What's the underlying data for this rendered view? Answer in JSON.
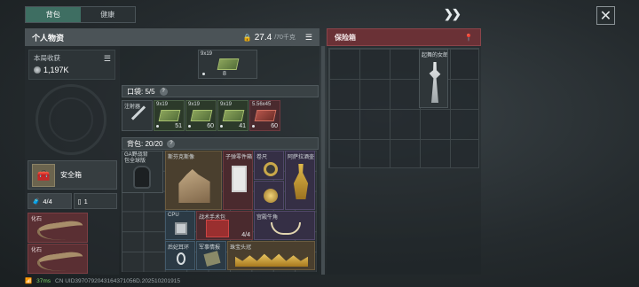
{
  "tabs": [
    {
      "label": "背包",
      "active": true
    },
    {
      "label": "健康",
      "active": false
    }
  ],
  "personal": {
    "title": "个人物资",
    "weight_value": "27.4",
    "weight_max": "/70千克"
  },
  "safe_panel": {
    "title": "保险箱"
  },
  "income": {
    "label": "本局收获",
    "value": "1,197K"
  },
  "safebox": {
    "label": "安全箱"
  },
  "counts": [
    {
      "value": "4/4"
    },
    {
      "value": "1"
    }
  ],
  "fossils": [
    {
      "label": "化石"
    },
    {
      "label": "化石"
    }
  ],
  "top_ammo": {
    "name": "9x19",
    "count": "8"
  },
  "pockets": {
    "label": "口袋: 5/5",
    "help": "?",
    "items": [
      {
        "name": "注射器",
        "count": ""
      },
      {
        "name": "9x19",
        "count": "51"
      },
      {
        "name": "9x19",
        "count": "60"
      },
      {
        "name": "9x19",
        "count": "41"
      },
      {
        "name": "5.56x45",
        "count": "60"
      }
    ]
  },
  "backpack": {
    "label": "背包: 20/20",
    "help": "?",
    "items": [
      {
        "name": "GA野战背包全球版"
      },
      {
        "name": "斯芬克斯像"
      },
      {
        "name": "子弹零件箱"
      },
      {
        "name": "卷尺"
      },
      {
        "name": "阿萨拉酒壶"
      },
      {
        "name": "CPU"
      },
      {
        "name": "战术手术包",
        "count": "4/4"
      },
      {
        "name": "宫殿牛角"
      },
      {
        "name": "后妃耳环"
      },
      {
        "name": "军事情报"
      },
      {
        "name": "珠宝头冠"
      }
    ]
  },
  "safe_items": [
    {
      "name": "起舞的女郎"
    }
  ],
  "status": {
    "ping": "37ms",
    "id": "CN UID3970792043164371056D.202510201915"
  },
  "colors": {
    "accent_tab": "#3e6e62",
    "safe_header": "#6a3136"
  }
}
